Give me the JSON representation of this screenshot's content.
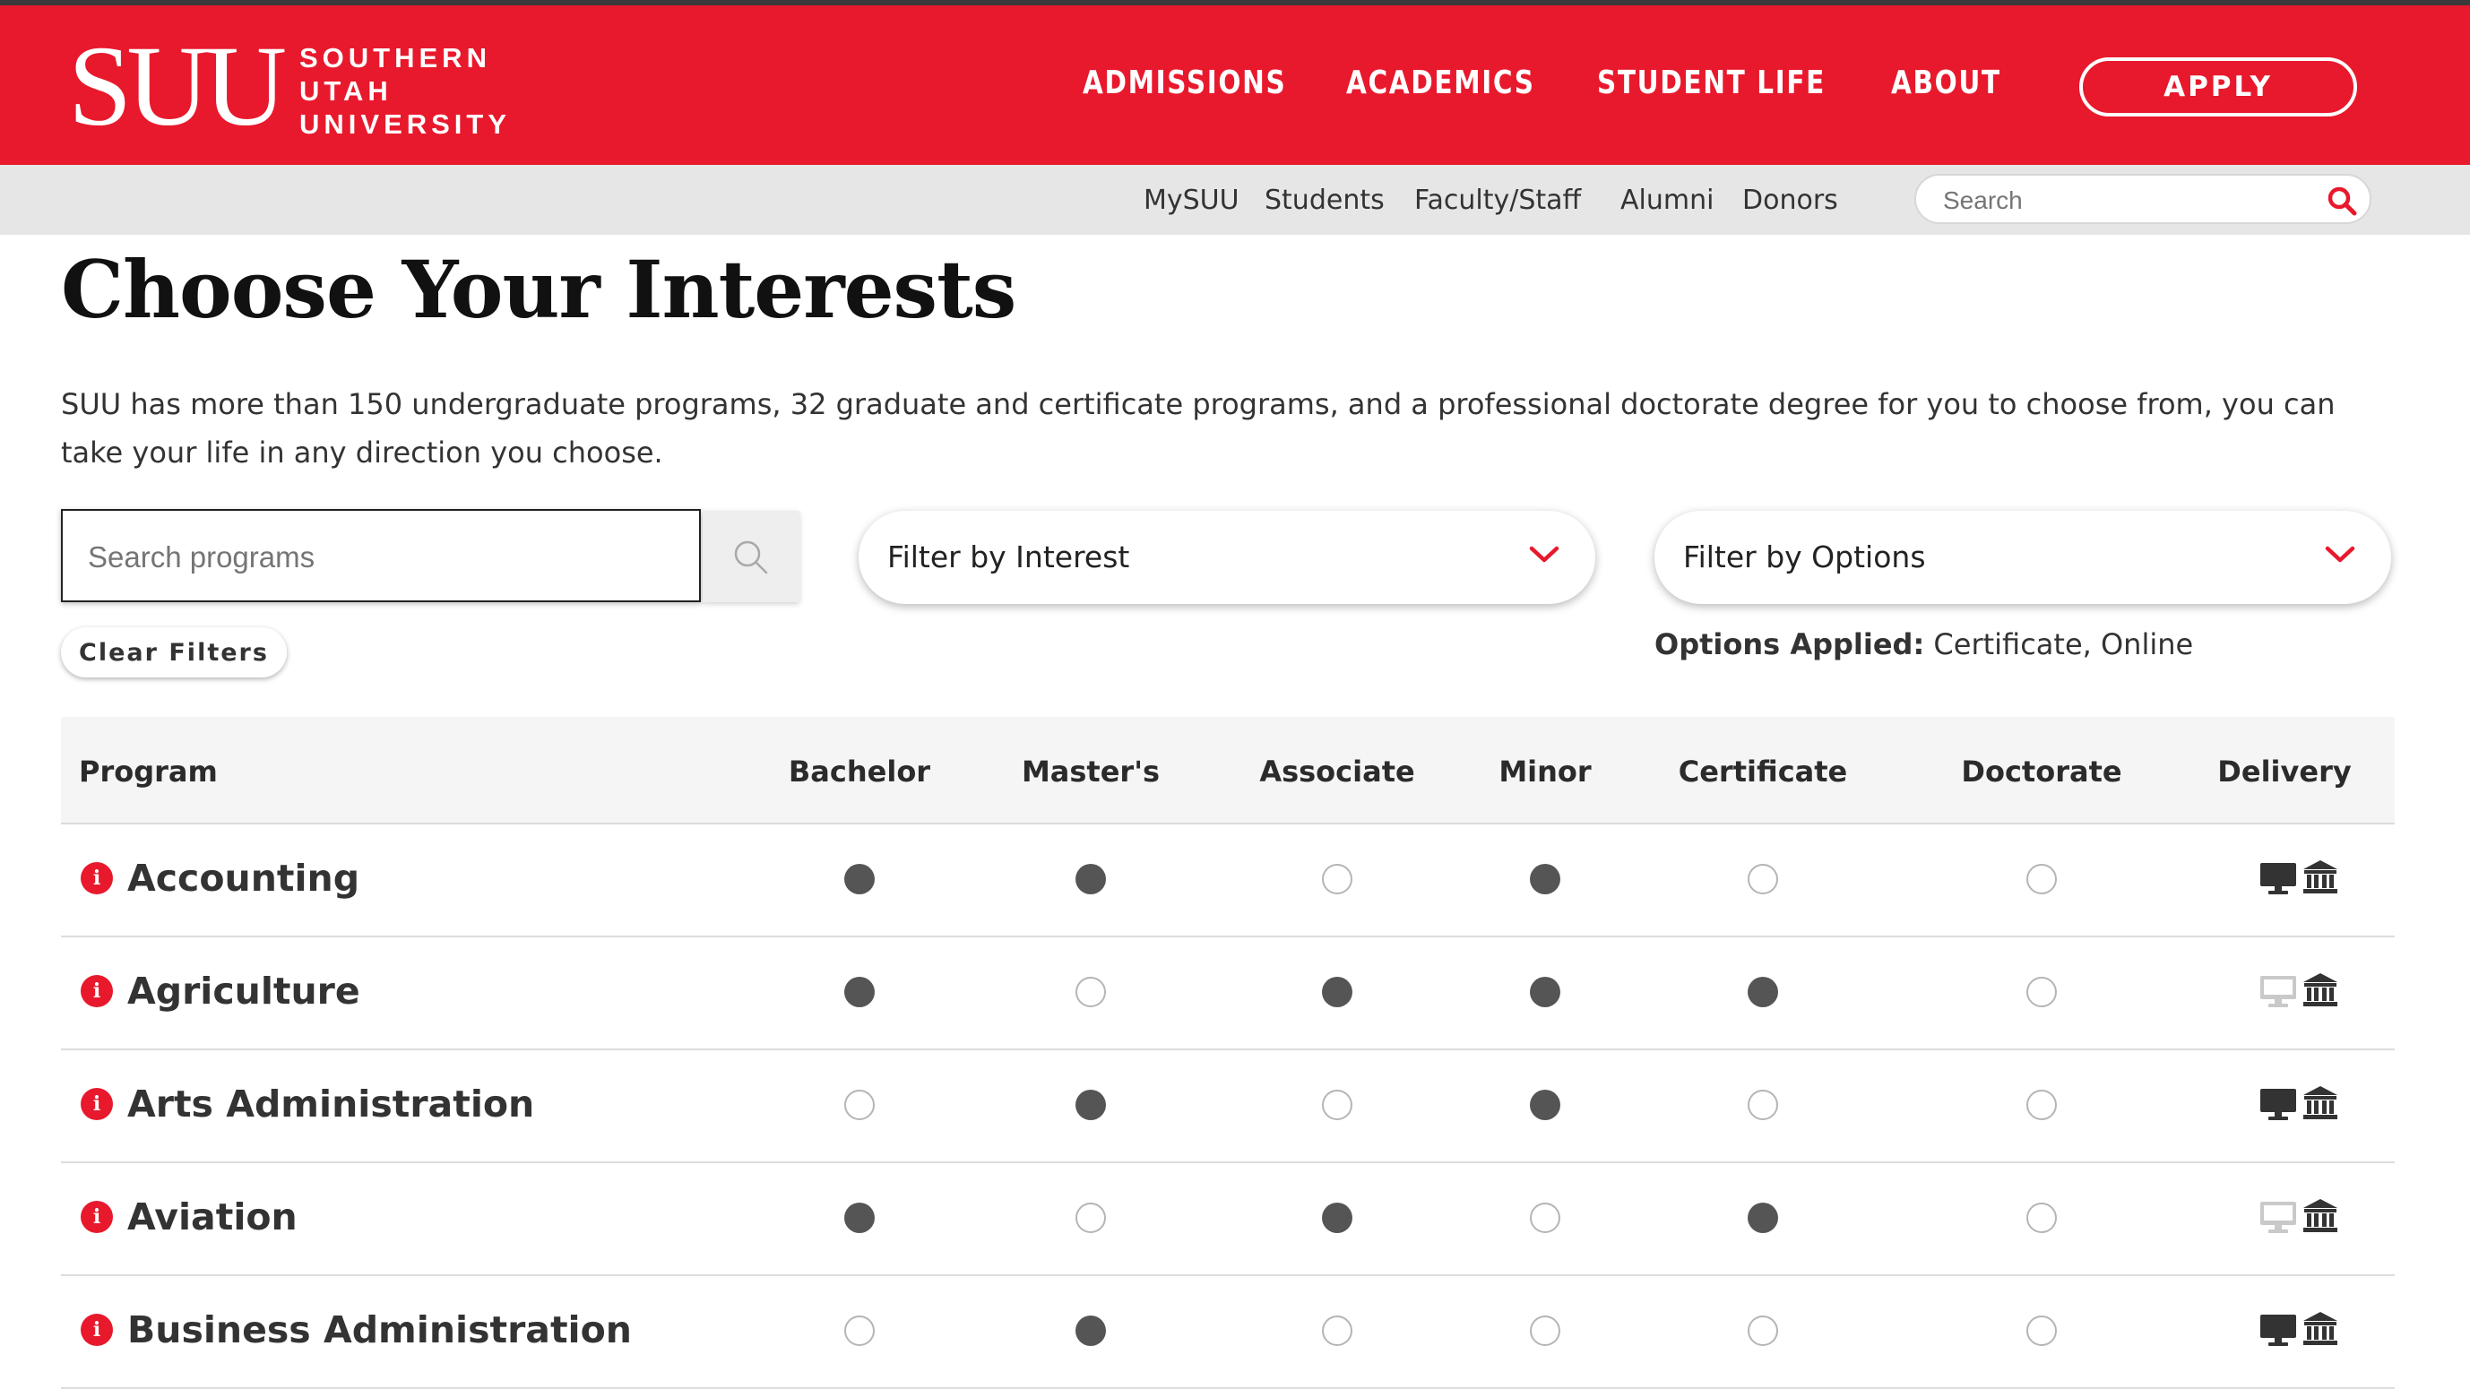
{
  "header": {
    "logo_mark": "SUU",
    "logo_lines": [
      "SOUTHERN",
      "UTAH",
      "UNIVERSITY"
    ],
    "nav": [
      "ADMISSIONS",
      "ACADEMICS",
      "STUDENT LIFE",
      "ABOUT"
    ],
    "apply_label": "APPLY",
    "brand_color": "#e8192c"
  },
  "subnav": {
    "links": [
      "MySUU",
      "Students",
      "Faculty/Staff",
      "Alumni",
      "Donors"
    ],
    "search_placeholder": "Search"
  },
  "main": {
    "title": "Choose Your Interests",
    "intro": "SUU has more than 150 undergraduate programs, 32 graduate and certificate programs, and a professional doctorate degree for you to choose from, you can take your life in any direction you choose.",
    "search_placeholder": "Search programs",
    "filter_interest": "Filter by Interest",
    "filter_options": "Filter by Options",
    "clear_filters": "Clear Filters",
    "options_applied_label": "Options Applied:",
    "options_applied_value": " Certificate, Online"
  },
  "table": {
    "columns": [
      "Program",
      "Bachelor",
      "Master's",
      "Associate",
      "Minor",
      "Certificate",
      "Doctorate",
      "Delivery"
    ],
    "rows": [
      {
        "name": "Accounting",
        "degrees": [
          true,
          true,
          false,
          true,
          false,
          false
        ],
        "online": true,
        "campus": true
      },
      {
        "name": "Agriculture",
        "degrees": [
          true,
          false,
          true,
          true,
          true,
          false
        ],
        "online": false,
        "campus": true
      },
      {
        "name": "Arts Administration",
        "degrees": [
          false,
          true,
          false,
          true,
          false,
          false
        ],
        "online": true,
        "campus": true
      },
      {
        "name": "Aviation",
        "degrees": [
          true,
          false,
          true,
          false,
          true,
          false
        ],
        "online": false,
        "campus": true
      },
      {
        "name": "Business Administration",
        "degrees": [
          false,
          true,
          false,
          false,
          false,
          false
        ],
        "online": true,
        "campus": true
      }
    ]
  }
}
